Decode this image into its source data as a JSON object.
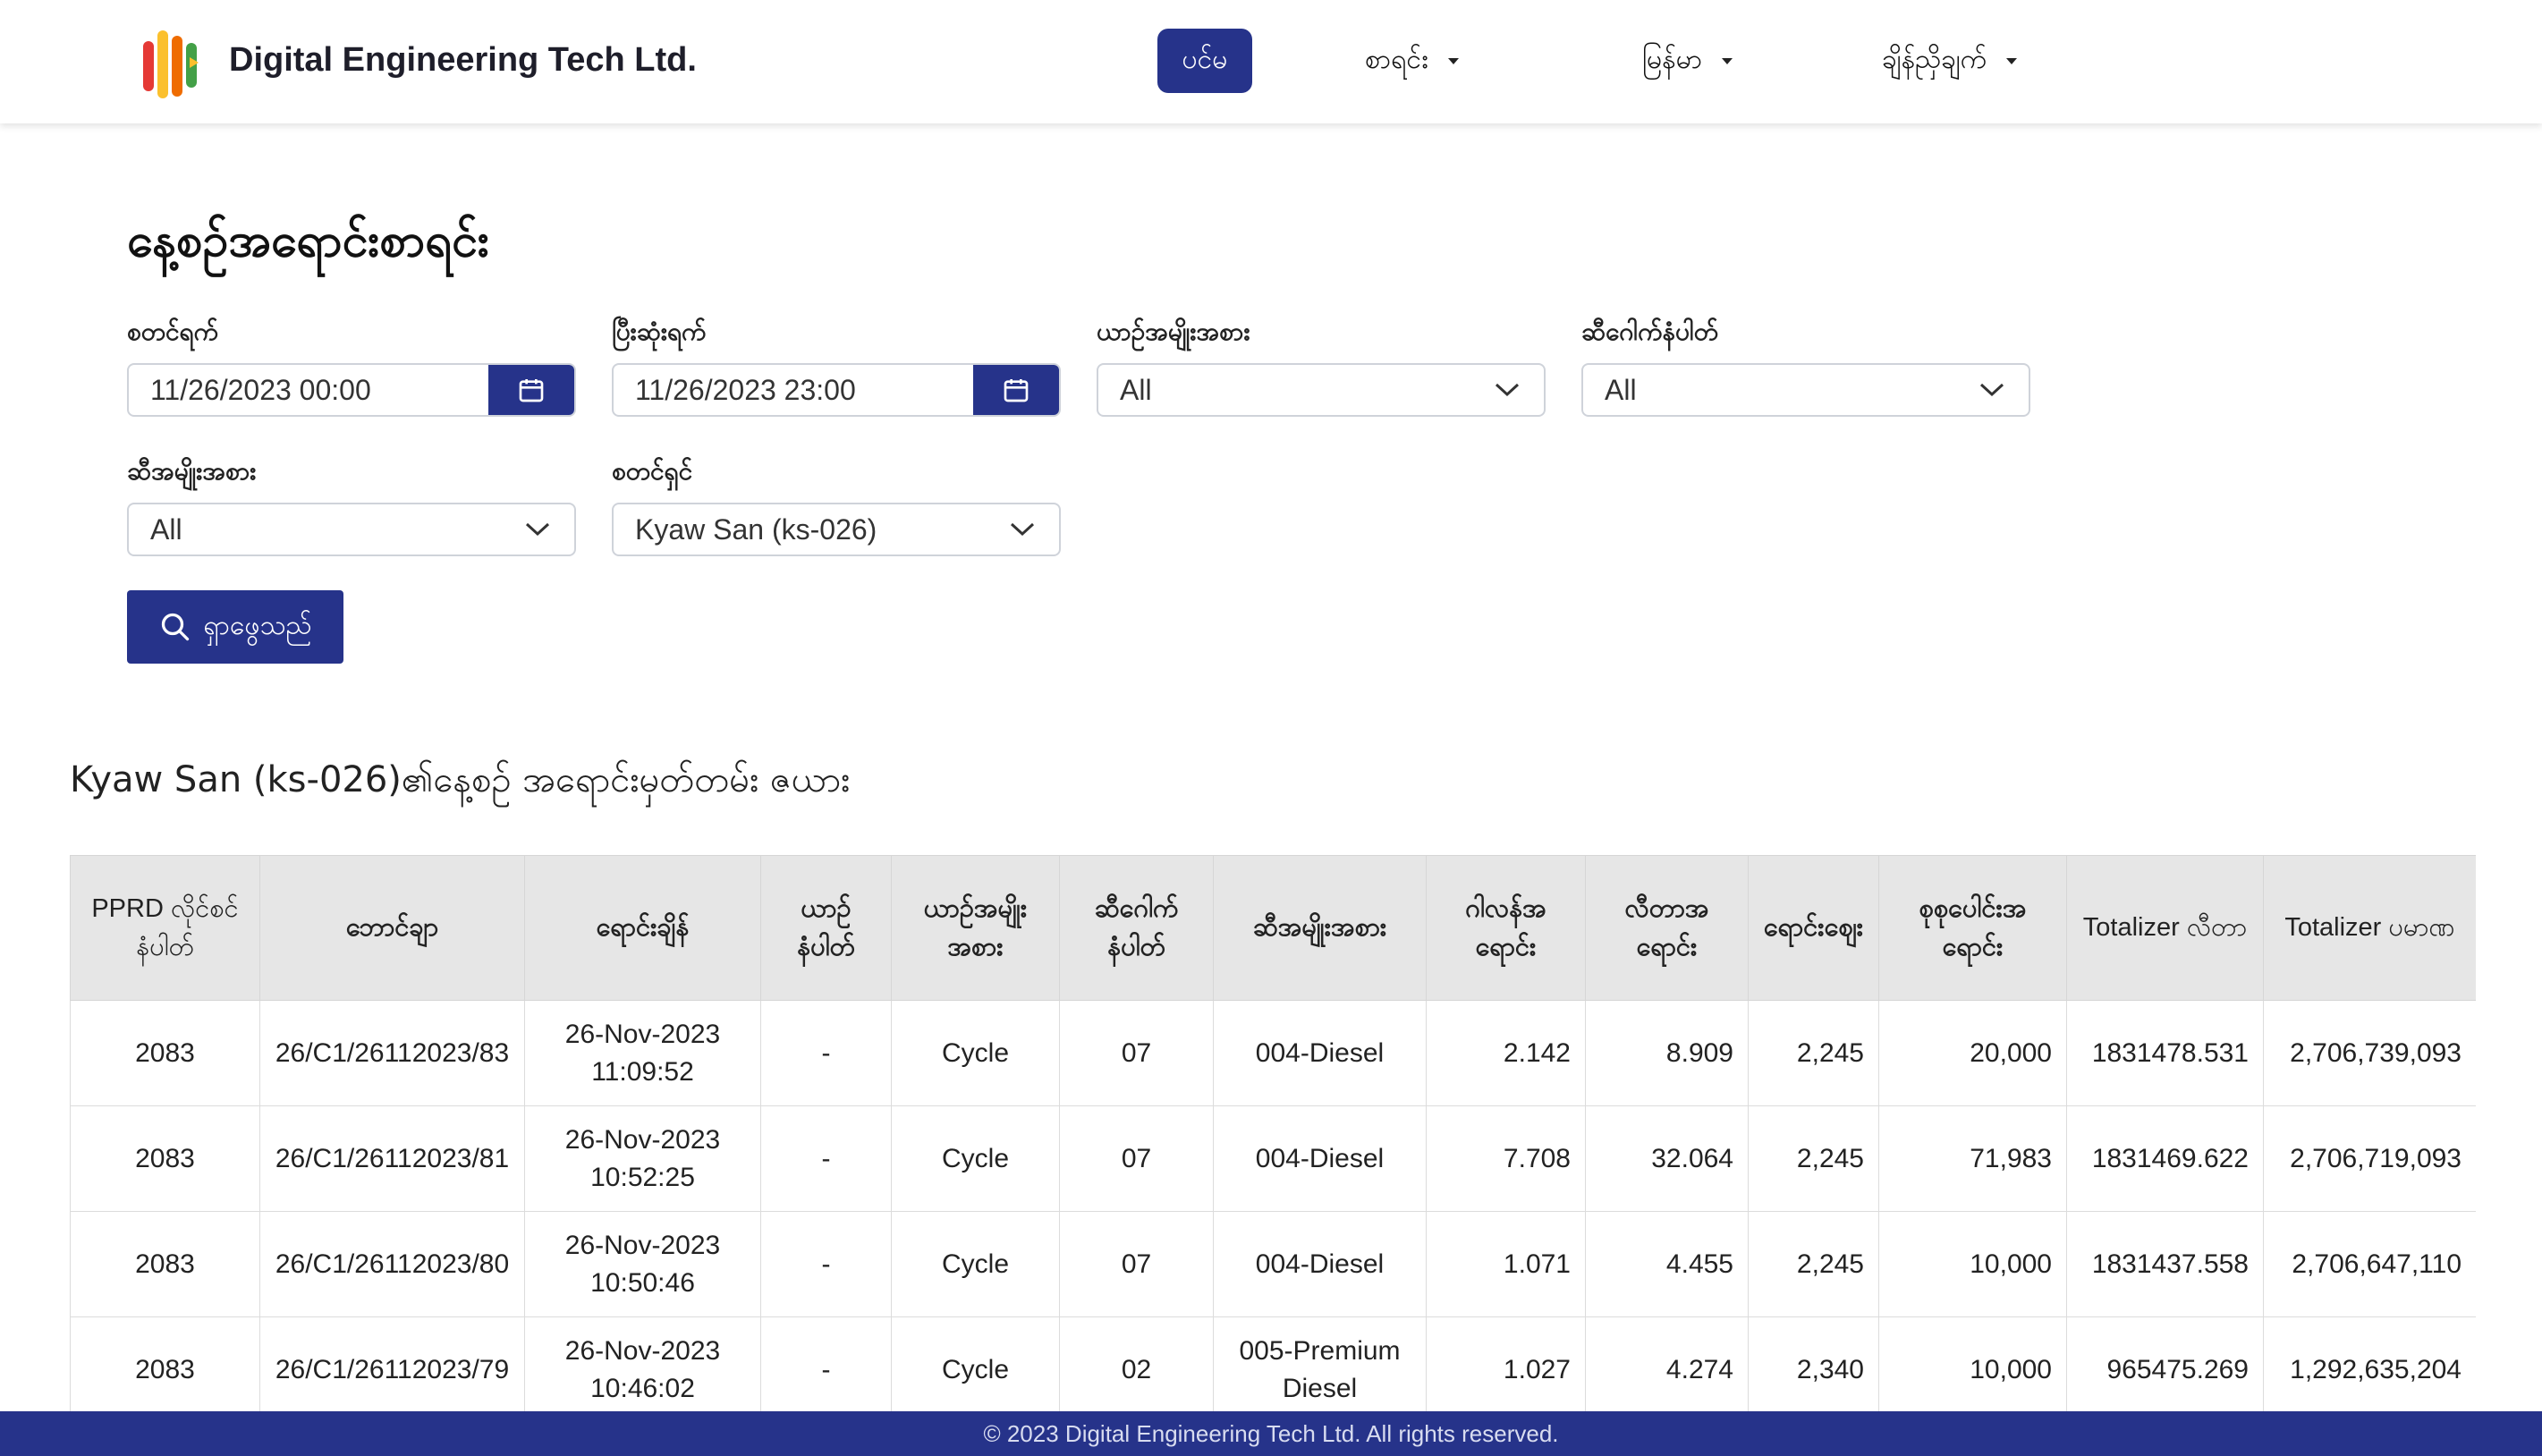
{
  "header": {
    "brand": "Digital Engineering Tech Ltd.",
    "nav": [
      {
        "label": "ပင်မ",
        "active": true
      },
      {
        "label": "စာရင်း",
        "active": false
      },
      {
        "label": "မြန်မာ",
        "active": false
      },
      {
        "label": "ချိန်ညှိချက်",
        "active": false
      }
    ]
  },
  "page_title": "နေ့စဉ်အရောင်းစာရင်း",
  "filters": {
    "start_date": {
      "label": "စတင်ရက်",
      "value": "11/26/2023 00:00"
    },
    "end_date": {
      "label": "ပြီးဆုံးရက်",
      "value": "11/26/2023 23:00"
    },
    "vehicle_type": {
      "label": "ယာဉ်အမျိုးအစား",
      "value": "All"
    },
    "nozzle_no": {
      "label": "ဆီဂေါက်နံပါတ်",
      "value": "All"
    },
    "fuel_type": {
      "label": "ဆီအမျိုးအစား",
      "value": "All"
    },
    "cashier": {
      "label": "စတင်ရှင်",
      "value": "Kyaw San (ks-026)"
    }
  },
  "search_button": "ရှာဖွေသည်",
  "section_title": "Kyaw San (ks-026)၏နေ့စဉ် အရောင်းမှတ်တမ်း ဇယား",
  "table": {
    "headers": [
      "PPRD လိုင်စင်နံပါတ်",
      "ဘောင်ချာ",
      "ရောင်းချိန်",
      "ယာဉ်နံပါတ်",
      "ယာဉ်အမျိုးအစား",
      "ဆီဂေါက်နံပါတ်",
      "ဆီအမျိုးအစား",
      "ဂါလန်အရောင်း",
      "လီတာအရောင်း",
      "ရောင်းဈေး",
      "စုစုပေါင်းအရောင်း",
      "Totalizer လီတာ",
      "Totalizer ပမာဏ"
    ],
    "rows": [
      [
        "2083",
        "26/C1/26112023/83",
        "26-Nov-2023 11:09:52",
        "-",
        "Cycle",
        "07",
        "004-Diesel",
        "2.142",
        "8.909",
        "2,245",
        "20,000",
        "1831478.531",
        "2,706,739,093"
      ],
      [
        "2083",
        "26/C1/26112023/81",
        "26-Nov-2023 10:52:25",
        "-",
        "Cycle",
        "07",
        "004-Diesel",
        "7.708",
        "32.064",
        "2,245",
        "71,983",
        "1831469.622",
        "2,706,719,093"
      ],
      [
        "2083",
        "26/C1/26112023/80",
        "26-Nov-2023 10:50:46",
        "-",
        "Cycle",
        "07",
        "004-Diesel",
        "1.071",
        "4.455",
        "2,245",
        "10,000",
        "1831437.558",
        "2,706,647,110"
      ],
      [
        "2083",
        "26/C1/26112023/79",
        "26-Nov-2023 10:46:02",
        "-",
        "Cycle",
        "02",
        "005-Premium Diesel",
        "1.027",
        "4.274",
        "2,340",
        "10,000",
        "965475.269",
        "1,292,635,204"
      ]
    ]
  },
  "footer": "© 2023 Digital Engineering Tech Ltd. All rights reserved.",
  "colors": {
    "primary": "#26338a",
    "header_bg": "#e6e6e6"
  }
}
